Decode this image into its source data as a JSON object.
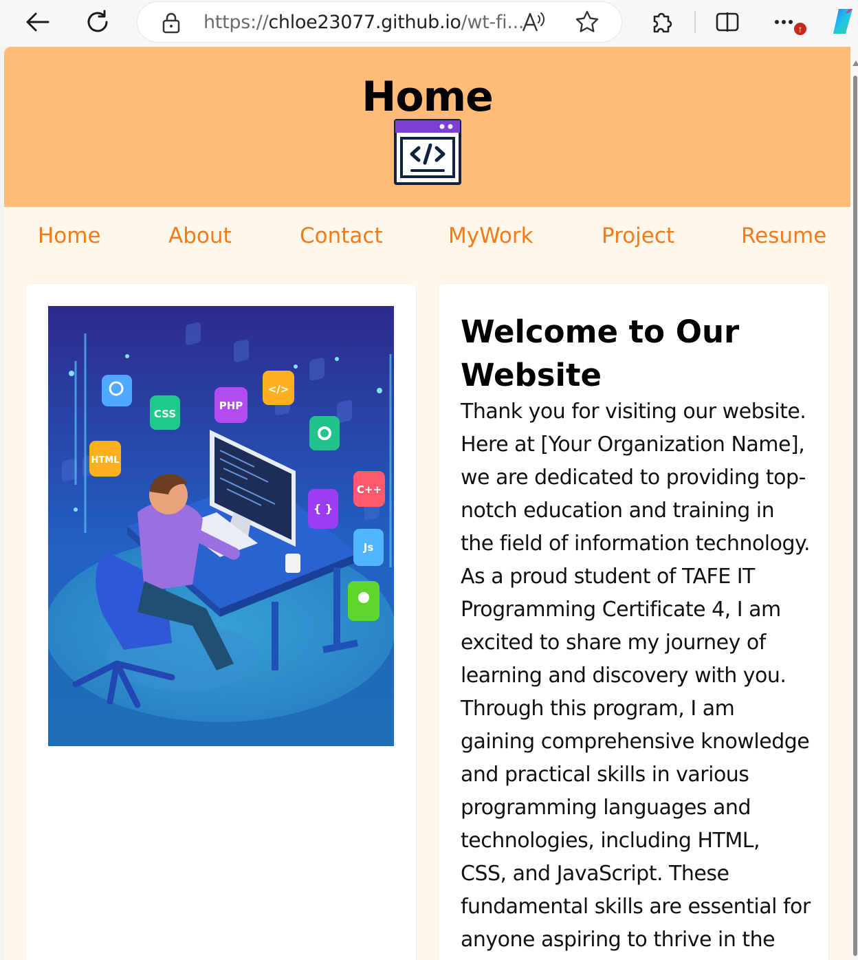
{
  "browser": {
    "url_scheme": "https://",
    "url_host": "chloe23077.github.io",
    "url_rest": "/wt-fi...",
    "notification_badge": "↑",
    "icons": [
      "back-arrow-icon",
      "refresh-icon",
      "lock-icon",
      "read-aloud-icon",
      "favorite-star-icon",
      "extensions-icon",
      "split-screen-icon",
      "more-icon",
      "copilot-icon"
    ]
  },
  "header": {
    "title": "Home",
    "logo_icon": "code-window-icon",
    "background": "#ffbb77"
  },
  "nav": {
    "items": [
      {
        "label": "Home"
      },
      {
        "label": "About"
      },
      {
        "label": "Contact"
      },
      {
        "label": "MyWork"
      },
      {
        "label": "Project"
      },
      {
        "label": "Resume"
      }
    ],
    "link_color": "#f57a1a"
  },
  "main": {
    "hero_image": {
      "badges": [
        "CSS",
        "PHP",
        "</>",
        "HTML",
        "C++",
        "{ }",
        "Js"
      ]
    },
    "welcome": {
      "title": "Welcome to Our Website",
      "body": "Thank you for visiting our website. Here at [Your Organization Name], we are dedicated to providing top-notch education and training in the field of information technology. As a proud student of TAFE IT Programming Certificate 4, I am excited to share my journey of learning and discovery with you. Through this program, I am gaining comprehensive knowledge and practical skills in various programming languages and technologies, including HTML, CSS, and JavaScript. These fundamental skills are essential for anyone aspiring to thrive in the dynamic"
    }
  },
  "colors": {
    "page_background": "#fff8ea",
    "card_background": "#ffffff"
  }
}
